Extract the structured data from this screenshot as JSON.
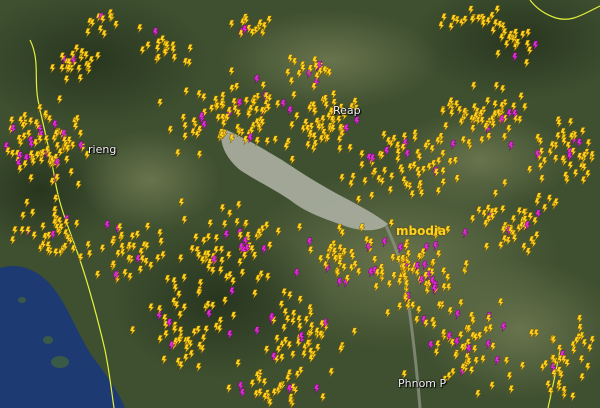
{
  "map": {
    "type": "satellite-lightning-overlay",
    "colors": {
      "land_dark": "#34452a",
      "land_light": "#6f7a52",
      "lake": "#a8aea0",
      "sea": "#1d3a73",
      "border": "#e4f03c",
      "bolt_primary": "#ffd21f",
      "bolt_outline": "#7a5a00",
      "bolt_secondary": "#e02bd6"
    },
    "legend": "none",
    "icon": "lightning-bolt-icon",
    "labels": {
      "siem_reap_partial": "Reap",
      "kampong_chhnang_partial": "rieng",
      "cambodia_partial": "mbodia",
      "phnom_penh_partial": "Phnom P"
    }
  }
}
